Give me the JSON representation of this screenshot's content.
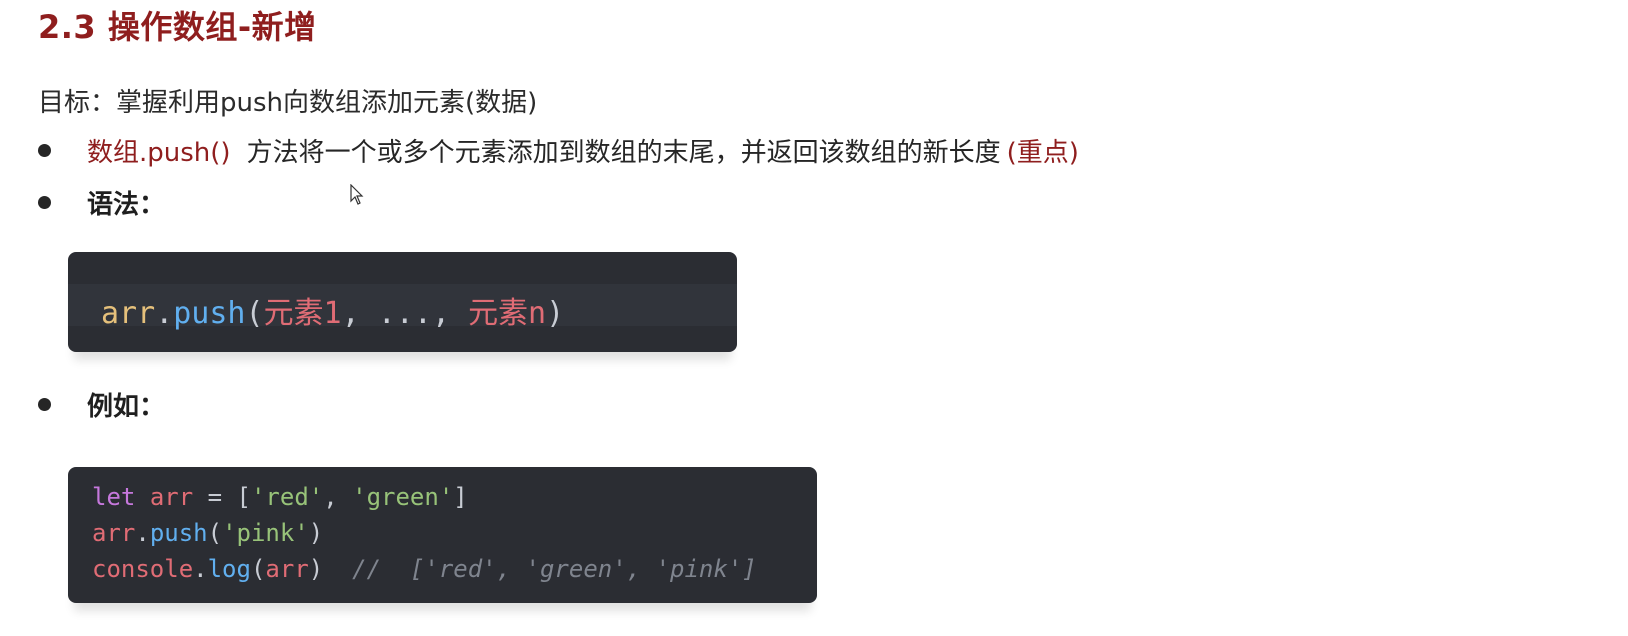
{
  "title": "2.3 操作数组-新增",
  "goal": "目标：掌握利用push向数组添加元素(数据)",
  "bullets": {
    "method_name": "数组.push()",
    "method_desc": "方法将一个或多个元素添加到数组的末尾，并返回该数组的新长度",
    "method_tag": "(重点)",
    "syntax_label": "语法：",
    "example_label": "例如："
  },
  "syntax_code": {
    "obj": "arr",
    "dot": ".",
    "fn": "push",
    "open": "(",
    "arg1": "元素1",
    "sep1": ", ",
    "ellipsis": "...",
    "sep2": ", ",
    "argn": "元素n",
    "close": ")"
  },
  "example_code": {
    "l1_kw": "let",
    "l1_id": "arr",
    "l1_eq": " = [",
    "l1_s1": "'red'",
    "l1_comma": ", ",
    "l1_s2": "'green'",
    "l1_end": "]",
    "l2_obj": "arr",
    "l2_dot": ".",
    "l2_fn": "push",
    "l2_open": "(",
    "l2_s": "'pink'",
    "l2_close": ")",
    "l3_obj": "console",
    "l3_dot": ".",
    "l3_fn": "log",
    "l3_open": "(",
    "l3_arg": "arr",
    "l3_close": ")",
    "l3_comment": "//  ['red', 'green', 'pink']"
  },
  "colors": {
    "accent": "#8f1e1e",
    "code_bg": "#2b2d33"
  },
  "icons": {
    "cursor": "mouse-pointer-icon",
    "bullet": "bullet-dot-icon"
  }
}
